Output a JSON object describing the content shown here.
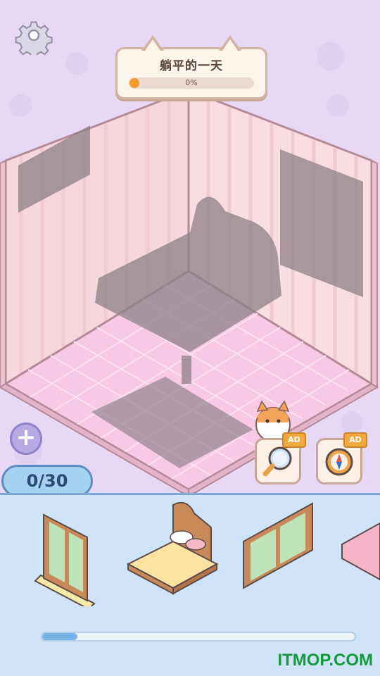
{
  "level": {
    "title": "躺平的一天",
    "progress_text": "0%",
    "progress_value": 0
  },
  "counter": {
    "label": "0/30"
  },
  "tools": [
    {
      "name": "magnifier",
      "badge": "AD"
    },
    {
      "name": "compass",
      "badge": "AD"
    }
  ],
  "tray": {
    "items": [
      "tall-window",
      "wooden-bed",
      "sliding-window",
      "pink-rug"
    ],
    "scroll_position": 0.1
  },
  "watermark": "ITMOP.COM",
  "colors": {
    "wall": "#f6d7de",
    "floor": "#f7c9e4",
    "tray": "#cfe4f8",
    "accent": "#f49a2b"
  }
}
